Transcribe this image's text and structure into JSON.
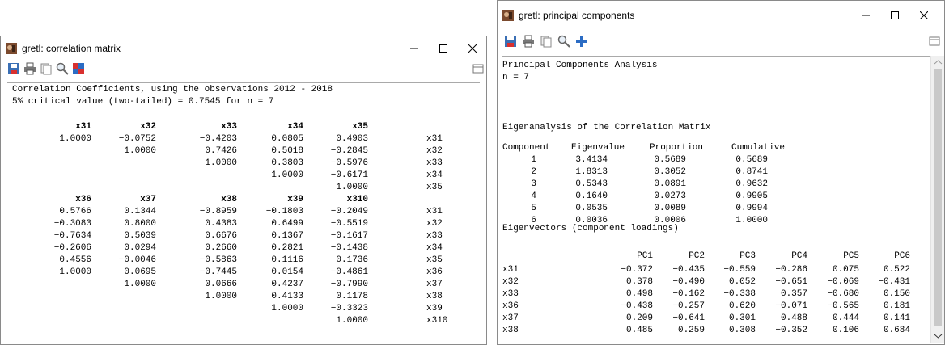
{
  "colors": {
    "window_bg": "#ffffff",
    "border": "#8a8a8a",
    "accent_red": "#d9302f",
    "accent_blue": "#2b6cc4"
  },
  "windows": {
    "corr": {
      "title": "gretl: correlation matrix",
      "toolbar_icons": [
        "save-icon",
        "print-icon",
        "copy-icon",
        "find-icon",
        "heatmap-icon"
      ],
      "text": [
        "Correlation Coefficients, using the observations 2012 - 2018",
        "5% critical value (two-tailed) = 0.7545 for n = 7"
      ],
      "block1": {
        "headers": [
          "x31",
          "x32",
          "x33",
          "x34",
          "x35"
        ],
        "rows": [
          {
            "cells": [
              "1.0000",
              "−0.0752",
              "−0.4203",
              "0.0805",
              "0.4903"
            ],
            "label": "x31"
          },
          {
            "cells": [
              "",
              "1.0000",
              "0.7426",
              "0.5018",
              "−0.2845"
            ],
            "label": "x32"
          },
          {
            "cells": [
              "",
              "",
              "1.0000",
              "0.3803",
              "−0.5976"
            ],
            "label": "x33"
          },
          {
            "cells": [
              "",
              "",
              "",
              "1.0000",
              "−0.6171"
            ],
            "label": "x34"
          },
          {
            "cells": [
              "",
              "",
              "",
              "",
              "1.0000"
            ],
            "label": "x35"
          }
        ]
      },
      "block2": {
        "headers": [
          "x36",
          "x37",
          "x38",
          "x39",
          "x310"
        ],
        "rows": [
          {
            "cells": [
              "0.5766",
              "0.1344",
              "−0.8959",
              "−0.1803",
              "−0.2049"
            ],
            "label": "x31"
          },
          {
            "cells": [
              "−0.3083",
              "0.8000",
              "0.4383",
              "0.6499",
              "−0.5519"
            ],
            "label": "x32"
          },
          {
            "cells": [
              "−0.7634",
              "0.5039",
              "0.6676",
              "0.1367",
              "−0.1617"
            ],
            "label": "x33"
          },
          {
            "cells": [
              "−0.2606",
              "0.0294",
              "0.2660",
              "0.2821",
              "−0.1438"
            ],
            "label": "x34"
          },
          {
            "cells": [
              "0.4556",
              "−0.0046",
              "−0.5863",
              "0.1116",
              "0.1736"
            ],
            "label": "x35"
          },
          {
            "cells": [
              "1.0000",
              "0.0695",
              "−0.7445",
              "0.0154",
              "−0.4861"
            ],
            "label": "x36"
          },
          {
            "cells": [
              "",
              "1.0000",
              "0.0666",
              "0.4237",
              "−0.7990"
            ],
            "label": "x37"
          },
          {
            "cells": [
              "",
              "",
              "1.0000",
              "0.4133",
              "0.1178"
            ],
            "label": "x38"
          },
          {
            "cells": [
              "",
              "",
              "",
              "1.0000",
              "−0.3323"
            ],
            "label": "x39"
          },
          {
            "cells": [
              "",
              "",
              "",
              "",
              "1.0000"
            ],
            "label": "x310"
          }
        ]
      }
    },
    "pca": {
      "title": "gretl: principal components",
      "toolbar_icons": [
        "save-icon",
        "print-icon",
        "copy-icon",
        "find-icon",
        "add-icon"
      ],
      "intro": [
        "Principal Components Analysis",
        "n = 7",
        "",
        "Eigenanalysis of the Correlation Matrix"
      ],
      "eig_headers": [
        "Component",
        "Eigenvalue",
        "Proportion",
        "Cumulative"
      ],
      "eig_rows": [
        [
          "1",
          "3.4134",
          "0.5689",
          "0.5689"
        ],
        [
          "2",
          "1.8313",
          "0.3052",
          "0.8741"
        ],
        [
          "3",
          "0.5343",
          "0.0891",
          "0.9632"
        ],
        [
          "4",
          "0.1640",
          "0.0273",
          "0.9905"
        ],
        [
          "5",
          "0.0535",
          "0.0089",
          "0.9994"
        ],
        [
          "6",
          "0.0036",
          "0.0006",
          "1.0000"
        ]
      ],
      "ev_title": "Eigenvectors (component loadings)",
      "ev_headers": [
        "PC1",
        "PC2",
        "PC3",
        "PC4",
        "PC5",
        "PC6"
      ],
      "ev_rows": [
        {
          "label": "x31",
          "cells": [
            "−0.372",
            "−0.435",
            "−0.559",
            "−0.286",
            "0.075",
            "0.522"
          ]
        },
        {
          "label": "x32",
          "cells": [
            "0.378",
            "−0.490",
            "0.052",
            "−0.651",
            "−0.069",
            "−0.431"
          ]
        },
        {
          "label": "x33",
          "cells": [
            "0.498",
            "−0.162",
            "−0.338",
            "0.357",
            "−0.680",
            "0.150"
          ]
        },
        {
          "label": "x36",
          "cells": [
            "−0.438",
            "−0.257",
            "0.620",
            "−0.071",
            "−0.565",
            "0.181"
          ]
        },
        {
          "label": "x37",
          "cells": [
            "0.209",
            "−0.641",
            "0.301",
            "0.488",
            "0.444",
            "0.141"
          ]
        },
        {
          "label": "x38",
          "cells": [
            "0.485",
            "0.259",
            "0.308",
            "−0.352",
            "0.106",
            "0.684"
          ]
        }
      ]
    }
  }
}
